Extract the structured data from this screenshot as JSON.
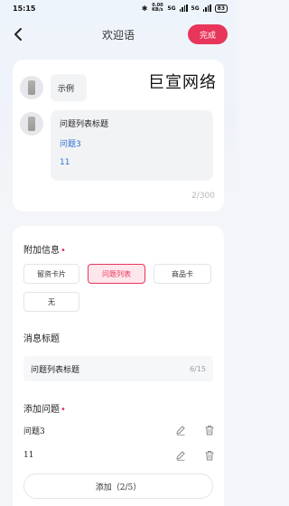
{
  "status_bar": {
    "time": "15:15",
    "net_speed": "0.00 KB/s",
    "network_1": "5G",
    "network_2": "5G",
    "battery": "83"
  },
  "nav": {
    "title": "欢迎语",
    "done_label": "完成"
  },
  "preview": {
    "greeting": "示例",
    "watermark": "巨宣网络",
    "question_title": "问题列表标题",
    "questions": [
      "问题3",
      "11"
    ],
    "counter": "2/300"
  },
  "form": {
    "attach_label": "附加信息",
    "attach_options": [
      "留资卡片",
      "问题列表",
      "商品卡",
      "无"
    ],
    "attach_selected": "问题列表",
    "title_label": "消息标题",
    "title_value": "问题列表标题",
    "title_counter": "6/15",
    "questions_label": "添加问题",
    "questions": [
      "问题3",
      "11"
    ],
    "add_button": "添加（2/5）"
  },
  "colors": {
    "accent": "#e8355a",
    "link": "#2f6fd0"
  }
}
